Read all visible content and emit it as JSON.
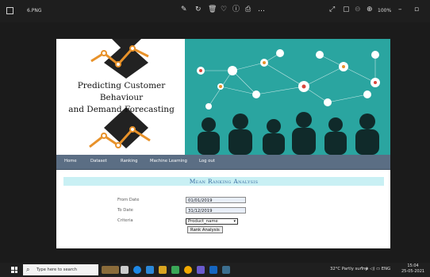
{
  "window": {
    "file_name": "6.PNG",
    "zoom": "100%"
  },
  "hero": {
    "title_line1": "Predicting Customer Behaviour",
    "title_line2": "and Demand Forecasting"
  },
  "nav": {
    "items": [
      "Home",
      "Dataset",
      "Ranking",
      "Machine Learning",
      "Log out"
    ]
  },
  "analysis": {
    "title": "Mean Ranking Analysis",
    "from_label": "From Date",
    "from_value": "01/01/2019",
    "to_label": "To Date",
    "to_value": "31/12/2019",
    "criteria_label": "Criteria",
    "criteria_value": "Product_name",
    "button_label": "Rank Analysis"
  },
  "taskbar": {
    "search_placeholder": "Type here to search",
    "weather": "32°C  Partly sunny",
    "lang": "ENG",
    "time": "15:04",
    "date": "25-05-2021"
  },
  "colors": {
    "teal": "#2aa5a0",
    "nav": "#5b6e84",
    "title_band": "#c9f0f4",
    "title_text": "#3b6fa3"
  }
}
